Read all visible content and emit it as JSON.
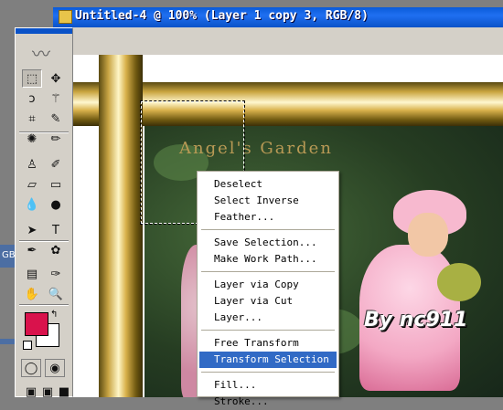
{
  "window": {
    "title": "Untitled-4 @ 100% (Layer 1 copy 3, RGB/8)"
  },
  "canvas": {
    "heading": "Angel's Garden",
    "signature": "By nc911"
  },
  "side_panel": {
    "label": "GB/"
  },
  "context_menu": {
    "groups": [
      [
        "Deselect",
        "Select Inverse",
        "Feather..."
      ],
      [
        "Save Selection...",
        "Make Work Path..."
      ],
      [
        "Layer via Copy",
        "Layer via Cut",
        "Layer..."
      ],
      [
        "Free Transform",
        "Transform Selection"
      ],
      [
        "Fill...",
        "Stroke..."
      ]
    ],
    "highlighted": "Transform Selection"
  },
  "toolbox": {
    "tools": [
      {
        "name": "rectangular-marquee-tool-icon",
        "glyph": "⬚",
        "active": true
      },
      {
        "name": "move-tool-icon",
        "glyph": "✥"
      },
      {
        "name": "lasso-tool-icon",
        "glyph": "ↄ"
      },
      {
        "name": "magic-wand-tool-icon",
        "glyph": "⚚"
      },
      {
        "name": "crop-tool-icon",
        "glyph": "⌗"
      },
      {
        "name": "slice-tool-icon",
        "glyph": "✎"
      },
      {
        "name": "healing-brush-tool-icon",
        "glyph": "✺"
      },
      {
        "name": "brush-tool-icon",
        "glyph": "✏"
      },
      {
        "name": "clone-stamp-tool-icon",
        "glyph": "♙"
      },
      {
        "name": "history-brush-tool-icon",
        "glyph": "✐"
      },
      {
        "name": "eraser-tool-icon",
        "glyph": "▱"
      },
      {
        "name": "gradient-tool-icon",
        "glyph": "▭"
      },
      {
        "name": "blur-tool-icon",
        "glyph": "💧"
      },
      {
        "name": "dodge-tool-icon",
        "glyph": "●"
      },
      {
        "name": "path-selection-tool-icon",
        "glyph": "➤"
      },
      {
        "name": "type-tool-icon",
        "glyph": "T"
      },
      {
        "name": "pen-tool-icon",
        "glyph": "✒"
      },
      {
        "name": "custom-shape-tool-icon",
        "glyph": "✿"
      },
      {
        "name": "notes-tool-icon",
        "glyph": "▤"
      },
      {
        "name": "eyedropper-tool-icon",
        "glyph": "✑"
      },
      {
        "name": "hand-tool-icon",
        "glyph": "✋"
      },
      {
        "name": "zoom-tool-icon",
        "glyph": "🔍"
      }
    ],
    "foreground_color": "#d9124c",
    "background_color": "#ffffff"
  }
}
